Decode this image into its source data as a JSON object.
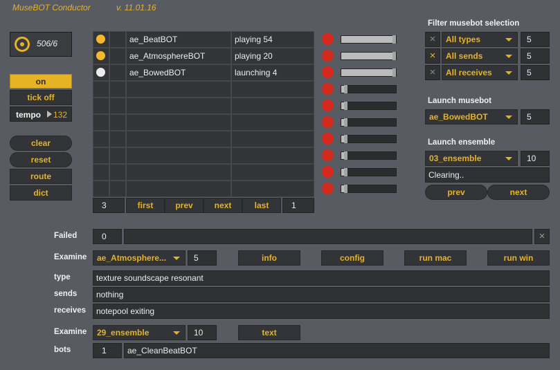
{
  "header": {
    "title": "MuseBOT Conductor",
    "version": "v. 11.01.16"
  },
  "left": {
    "counter": "506/6",
    "on_label": "on",
    "tick_label": "tick off",
    "tempo_label": "tempo",
    "tempo_value": "132",
    "clear": "clear",
    "reset": "reset",
    "route": "route",
    "dict": "dict"
  },
  "table": {
    "rows": [
      {
        "status": "active",
        "name": "ae_BeatBOT",
        "state": "playing 54"
      },
      {
        "status": "active",
        "name": "ae_AtmosphereBOT",
        "state": "playing 20"
      },
      {
        "status": "idle",
        "name": "ae_BowedBOT",
        "state": "launching 4"
      },
      {
        "status": "",
        "name": "",
        "state": ""
      },
      {
        "status": "",
        "name": "",
        "state": ""
      },
      {
        "status": "",
        "name": "",
        "state": ""
      },
      {
        "status": "",
        "name": "",
        "state": ""
      },
      {
        "status": "",
        "name": "",
        "state": ""
      },
      {
        "status": "",
        "name": "",
        "state": ""
      },
      {
        "status": "",
        "name": "",
        "state": ""
      }
    ],
    "count": "3",
    "page": "1",
    "first": "first",
    "prev": "prev",
    "next": "next",
    "last": "last",
    "levels": [
      0.96,
      0.96,
      0.96,
      0.05,
      0.05,
      0.05,
      0.05,
      0.05,
      0.05,
      0.05
    ]
  },
  "filter": {
    "heading": "Filter musebot selection",
    "rows": [
      {
        "mark": "×",
        "marked": false,
        "value": "All types",
        "num": "5"
      },
      {
        "mark": "×",
        "marked": true,
        "value": "All sends",
        "num": "5"
      },
      {
        "mark": "×",
        "marked": false,
        "value": "All receives",
        "num": "5"
      }
    ]
  },
  "launch_musebot": {
    "heading": "Launch musebot",
    "value": "ae_BowedBOT",
    "num": "5"
  },
  "launch_ensemble": {
    "heading": "Launch ensemble",
    "value": "03_ensemble",
    "num": "10",
    "status": "Clearing..",
    "prev": "prev",
    "next": "next"
  },
  "failed": {
    "label": "Failed",
    "count": "0",
    "text": "",
    "close": "×"
  },
  "examine": {
    "label": "Examine",
    "value": "ae_Atmosphere...",
    "num": "5",
    "info": "info",
    "config": "config",
    "run_mac": "run mac",
    "run_win": "run win"
  },
  "details": {
    "type_label": "type",
    "type": "texture soundscape resonant",
    "sends_label": "sends",
    "sends": "nothing",
    "receives_label": "receives",
    "receives": "notepool exiting"
  },
  "examine2": {
    "label": "Examine",
    "value": "29_ensemble",
    "num": "10",
    "text": "text"
  },
  "bots": {
    "label": "bots",
    "count": "1",
    "value": "ae_CleanBeatBOT"
  },
  "colors": {
    "accent": "#e6b325",
    "led_red": "#d42a1e",
    "background": "#585c62"
  }
}
